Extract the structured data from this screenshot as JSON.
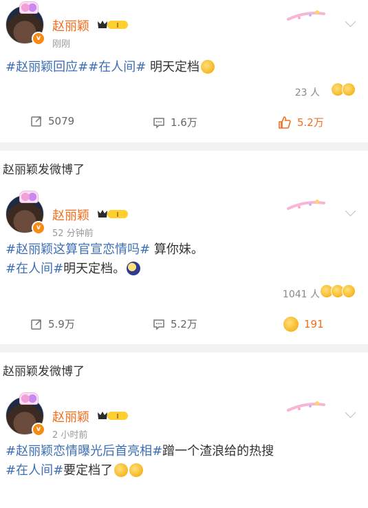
{
  "posts": [
    {
      "name": "赵丽颖",
      "vip_level": "I",
      "time": "刚刚",
      "text_parts": [
        {
          "t": "#赵丽颖回应##在人间#",
          "tag": true
        },
        {
          "t": " 明天定档",
          "tag": false
        }
      ],
      "like_people": "23 人",
      "repost": "5079",
      "comment": "1.6万",
      "like": "5.2万",
      "like_style": "thumb"
    },
    {
      "section_label": "赵丽颖发微博了",
      "name": "赵丽颖",
      "vip_level": "I",
      "time": "52 分钟前",
      "line1": [
        {
          "t": "#赵丽颖这算官宣恋情吗#",
          "tag": true
        },
        {
          "t": " 算你妹。",
          "tag": false
        }
      ],
      "line2": [
        {
          "t": "#在人间#",
          "tag": true
        },
        {
          "t": "明天定档。",
          "tag": false
        }
      ],
      "like_people": "1041 人",
      "repost": "5.9万",
      "comment": "5.2万",
      "like": "191",
      "like_style": "wow"
    },
    {
      "section_label": "赵丽颖发微博了",
      "name": "赵丽颖",
      "vip_level": "I",
      "time": "2 小时前",
      "line1": [
        {
          "t": "#赵丽颖恋情曝光后首亮相#",
          "tag": true
        },
        {
          "t": "蹭一个渣浪给的热搜",
          "tag": false
        }
      ],
      "line2": [
        {
          "t": "#在人间#",
          "tag": true
        },
        {
          "t": "要定档了",
          "tag": false
        }
      ]
    }
  ]
}
